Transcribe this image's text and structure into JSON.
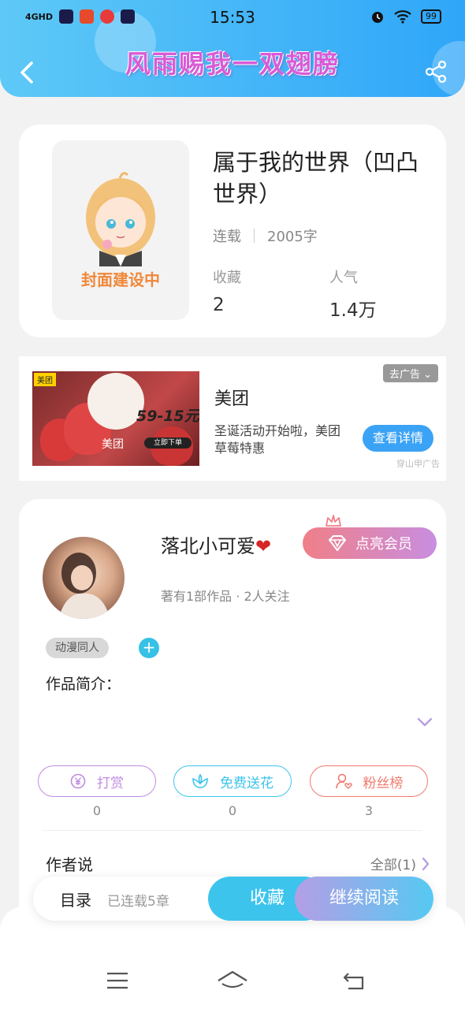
{
  "status_bar": {
    "signal": "4GHD",
    "time": "15:53",
    "battery": "99"
  },
  "header": {
    "title": "风雨赐我一双翅膀"
  },
  "book": {
    "title": "属于我的世界（凹凸世界）",
    "cover_text": "封面建设中",
    "status": "连载",
    "word_count": "2005字",
    "favorites_label": "收藏",
    "favorites_value": "2",
    "popularity_label": "人气",
    "popularity_value": "1.4万"
  },
  "ad": {
    "badge": "去广告",
    "title": "美团",
    "description": "圣诞活动开始啦，美团草莓特惠",
    "cta": "查看详情",
    "source": "穿山甲广告",
    "image_promo": "59-15元",
    "image_brand": "美团",
    "image_tag": "美团",
    "image_btn": "立即下单"
  },
  "author": {
    "name": "落北小可爱",
    "heart": "❤",
    "vip_label": "点亮会员",
    "meta": "著有1部作品 · 2人关注",
    "tag": "动漫同人",
    "add_tag": "+",
    "intro_label": "作品简介："
  },
  "actions": [
    {
      "label": "打赏",
      "count": "0"
    },
    {
      "label": "免费送花",
      "count": "0"
    },
    {
      "label": "粉丝榜",
      "count": "3"
    }
  ],
  "author_says": {
    "label": "作者说",
    "all_link": "全部(1)"
  },
  "bottom_bar": {
    "toc": "目录",
    "chapters": "已连载5章",
    "favorite": "收藏",
    "continue": "继续阅读"
  },
  "colors": {
    "header_start": "#5ec9f7",
    "header_end": "#2fa6f8",
    "accent_cyan": "#3dc4ec",
    "tip_purple": "#c08be0",
    "fans_red": "#f07a6e"
  }
}
